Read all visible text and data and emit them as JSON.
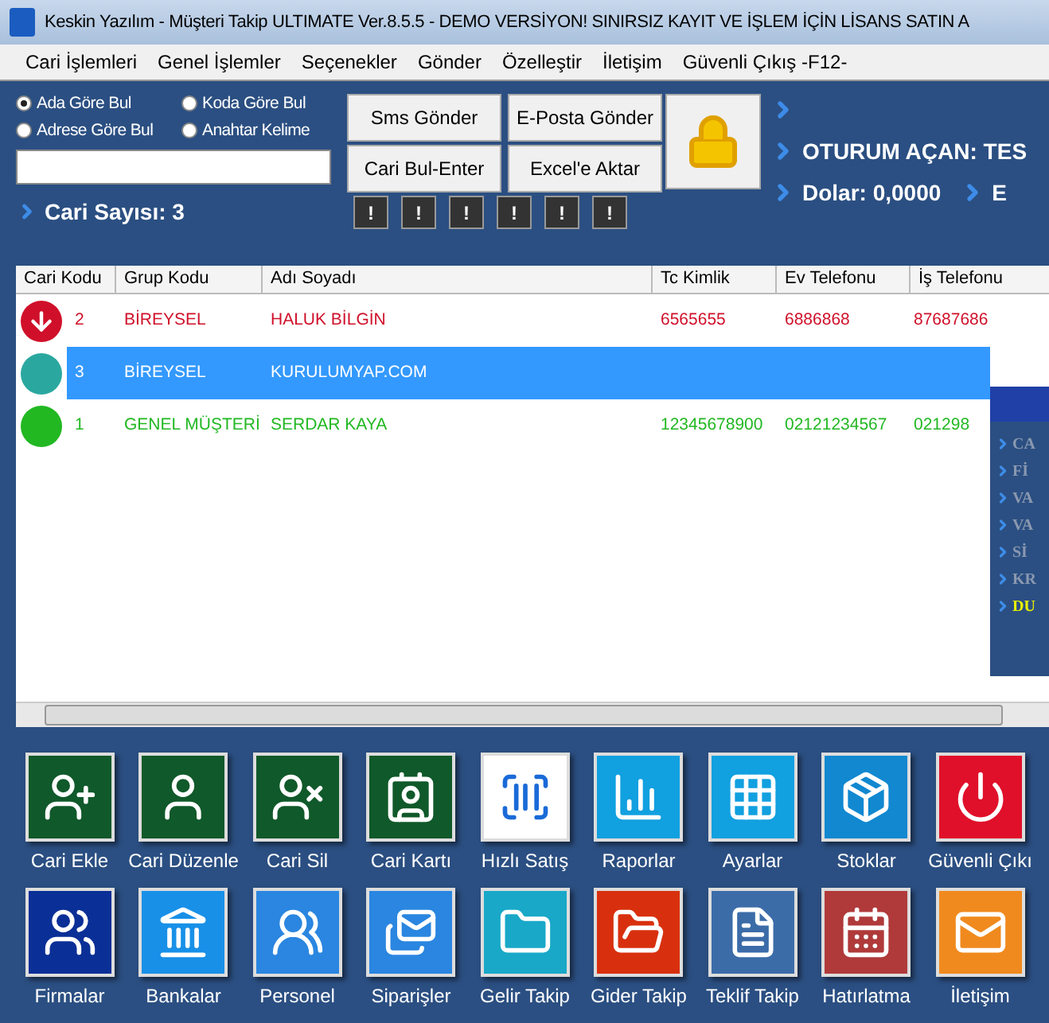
{
  "window": {
    "title": "Keskin Yazılım - Müşteri Takip ULTIMATE Ver.8.5.5  - DEMO VERSİYON! SINIRSIZ KAYIT VE İŞLEM İÇİN LİSANS SATIN A"
  },
  "menu": [
    "Cari İşlemleri",
    "Genel İşlemler",
    "Seçenekler",
    "Gönder",
    "Özelleştir",
    "İletişim",
    "Güvenli Çıkış -F12-"
  ],
  "search": {
    "options": [
      {
        "label": "Ada Göre Bul",
        "selected": true
      },
      {
        "label": "Koda Göre Bul",
        "selected": false
      },
      {
        "label": "Adrese Göre Bul",
        "selected": false
      },
      {
        "label": "Anahtar Kelime",
        "selected": false
      }
    ],
    "count": "Cari Sayısı: 3"
  },
  "buttons": [
    "Sms Gönder",
    "E-Posta Gönder",
    "Cari Bul-Enter",
    "Excel'e Aktar"
  ],
  "alerts": [
    "!",
    "!",
    "!",
    "!",
    "!",
    "!"
  ],
  "info": {
    "session": "OTURUM AÇAN: TES",
    "dollar": "Dolar: 0,0000",
    "cut": "E"
  },
  "table": {
    "columns": [
      "Cari Kodu",
      "Grup Kodu",
      "Adı Soyadı",
      "Tc Kimlik",
      "Ev Telefonu",
      "İş Telefonu"
    ],
    "rows": [
      {
        "kind": "down",
        "color": "#d0102a",
        "selected": false,
        "cells": [
          "2",
          "BİREYSEL",
          "HALUK BİLGİN",
          "6565655",
          "6886868",
          "87687686"
        ]
      },
      {
        "kind": "teal",
        "color": "#2aa8a0",
        "selected": true,
        "cells": [
          "3",
          "BİREYSEL",
          "KURULUMYAP.COM",
          "",
          "",
          ""
        ]
      },
      {
        "kind": "green",
        "color": "#22b822",
        "selected": false,
        "cells": [
          "1",
          "GENEL MÜŞTERİ",
          "SERDAR KAYA",
          "12345678900",
          "02121234567",
          "021298"
        ]
      }
    ]
  },
  "side_panel": {
    "items": [
      {
        "label": "CA",
        "highlighted": false
      },
      {
        "label": "Fİ",
        "highlighted": false
      },
      {
        "label": "VA",
        "highlighted": false
      },
      {
        "label": "VA",
        "highlighted": false
      },
      {
        "label": "Sİ",
        "highlighted": false
      },
      {
        "label": "KR",
        "highlighted": false
      },
      {
        "label": "DU",
        "highlighted": true
      }
    ]
  },
  "tiles": [
    {
      "label": "Cari Ekle",
      "color": "#10592a"
    },
    {
      "label": "Cari Düzenle",
      "color": "#10592a"
    },
    {
      "label": "Cari Sil",
      "color": "#10592a"
    },
    {
      "label": "Cari Kartı",
      "color": "#10592a"
    },
    {
      "label": "Hızlı Satış",
      "color": "#ffffff"
    },
    {
      "label": "Raporlar",
      "color": "#11a0e0"
    },
    {
      "label": "Ayarlar",
      "color": "#11a0e0"
    },
    {
      "label": "Stoklar",
      "color": "#1188d0"
    },
    {
      "label": "Güvenli Çıkı",
      "color": "#e0102a"
    },
    {
      "label": "Firmalar",
      "color": "#0a2f96"
    },
    {
      "label": "Bankalar",
      "color": "#1890e8"
    },
    {
      "label": "Personel",
      "color": "#2a86e0"
    },
    {
      "label": "Siparişler",
      "color": "#2a86e0"
    },
    {
      "label": "Gelir Takip",
      "color": "#19a8c8"
    },
    {
      "label": "Gider Takip",
      "color": "#d8300e"
    },
    {
      "label": "Teklif Takip",
      "color": "#3c6ca8"
    },
    {
      "label": "Hatırlatma",
      "color": "#b03a3a"
    },
    {
      "label": "İletişim",
      "color": "#f08a1e"
    }
  ]
}
